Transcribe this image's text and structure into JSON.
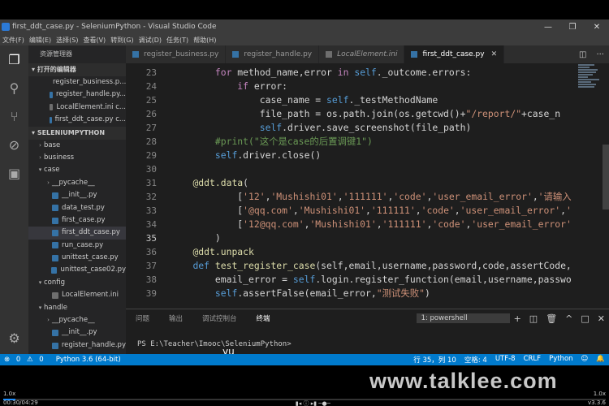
{
  "window": {
    "title": "first_ddt_case.py - SeleniumPython - Visual Studio Code"
  },
  "menu": [
    "文件(F)",
    "编辑(E)",
    "选择(S)",
    "查看(V)",
    "转到(G)",
    "调试(D)",
    "任务(T)",
    "帮助(H)"
  ],
  "sidebar": {
    "header": "资源管理器",
    "open_editors_title": "打开的编辑器",
    "open_editors": [
      {
        "label": "register_business.p...",
        "type": "py"
      },
      {
        "label": "register_handle.py...",
        "type": "py"
      },
      {
        "label": "LocalElement.ini c...",
        "type": "ini"
      },
      {
        "label": "first_ddt_case.py c...",
        "type": "py"
      }
    ],
    "project_title": "SELENIUMPYTHON",
    "tree": [
      {
        "label": "base",
        "kind": "folder",
        "indent": 1,
        "open": false
      },
      {
        "label": "business",
        "kind": "folder",
        "indent": 1,
        "open": false
      },
      {
        "label": "case",
        "kind": "folder",
        "indent": 1,
        "open": true
      },
      {
        "label": "__pycache__",
        "kind": "folder",
        "indent": 2,
        "open": false
      },
      {
        "label": "__init__.py",
        "kind": "py",
        "indent": 2
      },
      {
        "label": "data_test.py",
        "kind": "py",
        "indent": 2
      },
      {
        "label": "first_case.py",
        "kind": "py",
        "indent": 2
      },
      {
        "label": "first_ddt_case.py",
        "kind": "py",
        "indent": 2,
        "selected": true
      },
      {
        "label": "run_case.py",
        "kind": "py",
        "indent": 2
      },
      {
        "label": "unittest_case.py",
        "kind": "py",
        "indent": 2
      },
      {
        "label": "unittest_case02.py",
        "kind": "py",
        "indent": 2
      },
      {
        "label": "config",
        "kind": "folder",
        "indent": 1,
        "open": true
      },
      {
        "label": "LocalElement.ini",
        "kind": "ini",
        "indent": 2
      },
      {
        "label": "handle",
        "kind": "folder",
        "indent": 1,
        "open": true
      },
      {
        "label": "__pycache__",
        "kind": "folder",
        "indent": 2,
        "open": false
      },
      {
        "label": "__init__.py",
        "kind": "py",
        "indent": 2
      },
      {
        "label": "register_handle.py",
        "kind": "py",
        "indent": 2
      }
    ]
  },
  "tabs": [
    {
      "label": "register_business.py",
      "type": "py",
      "active": false
    },
    {
      "label": "register_handle.py",
      "type": "py",
      "active": false
    },
    {
      "label": "LocalElement.ini",
      "type": "ini",
      "active": false
    },
    {
      "label": "first_ddt_case.py",
      "type": "py",
      "active": true
    }
  ],
  "editor": {
    "lines": [
      {
        "n": "23",
        "html": "        <span class='kw2'>for</span> method_name,error <span class='kw2'>in</span> <span class='self'>self</span>._outcome.errors:"
      },
      {
        "n": "24",
        "html": "            <span class='kw2'>if</span> error:"
      },
      {
        "n": "25",
        "html": "                case_name = <span class='self'>self</span>._testMethodName"
      },
      {
        "n": "26",
        "html": "                file_path = os.path.join(os.getcwd()+<span class='str'>\"/report/\"</span>+case_n"
      },
      {
        "n": "27",
        "html": "                <span class='self'>self</span>.driver.save_screenshot(file_path)"
      },
      {
        "n": "28",
        "html": "        <span class='cm'>#print(\"这个是case的后置调键1\")</span>"
      },
      {
        "n": "29",
        "html": "        <span class='self'>self</span>.driver.close()"
      },
      {
        "n": "30",
        "html": ""
      },
      {
        "n": "31",
        "html": "    <span class='dec'>@ddt.data</span>("
      },
      {
        "n": "32",
        "html": "            [<span class='str'>'12'</span>,<span class='str'>'Mushishi01'</span>,<span class='str'>'111111'</span>,<span class='str'>'code'</span>,<span class='str'>'user_email_error'</span>,<span class='str'>'请输入</span>"
      },
      {
        "n": "33",
        "html": "            [<span class='str'>'@qq.com'</span>,<span class='str'>'Mushishi01'</span>,<span class='str'>'111111'</span>,<span class='str'>'code'</span>,<span class='str'>'user_email_error'</span>,<span class='str'>'</span>"
      },
      {
        "n": "34",
        "html": "            [<span class='str'>'12@qq.com'</span>,<span class='str'>'Mushishi01'</span>,<span class='str'>'111111'</span>,<span class='str'>'code'</span>,<span class='str'>'user_email_error'</span>"
      },
      {
        "n": "35",
        "html": "        )"
      },
      {
        "n": "36",
        "html": "    <span class='dec'>@ddt.unpack</span>"
      },
      {
        "n": "37",
        "html": "    <span class='kw'>def</span> <span class='fn'>test_register_case</span>(self,email,username,password,code,assertCode,"
      },
      {
        "n": "38",
        "html": "        email_error = <span class='self'>self</span>.login.register_function(email,username,passwo"
      },
      {
        "n": "39",
        "html": "        <span class='self'>self</span>.assertFalse(email_error,<span class='str'>\"测试失败\"</span>)"
      }
    ],
    "current_line": "35"
  },
  "panel": {
    "tabs": [
      "问题",
      "输出",
      "调试控制台",
      "终端"
    ],
    "active_tab": "终端",
    "terminal_select": "1: powershell",
    "prompt": "PS E:\\Teacher\\Imooc\\SeleniumPython>"
  },
  "status": {
    "errors": "0",
    "warnings": "0",
    "python": "Python 3.6 (64-bit)",
    "position": "行 35，列 10",
    "spaces": "空格: 4",
    "encoding": "UTF-8",
    "eol": "CRLF",
    "language": "Python"
  },
  "overlay": {
    "subtitle": "yu",
    "watermark": "www.talklee.com",
    "player_time": "00:30/04:29",
    "speed_left": "1.0x",
    "speed_right": "1.0x",
    "version": "v3.3.6"
  }
}
